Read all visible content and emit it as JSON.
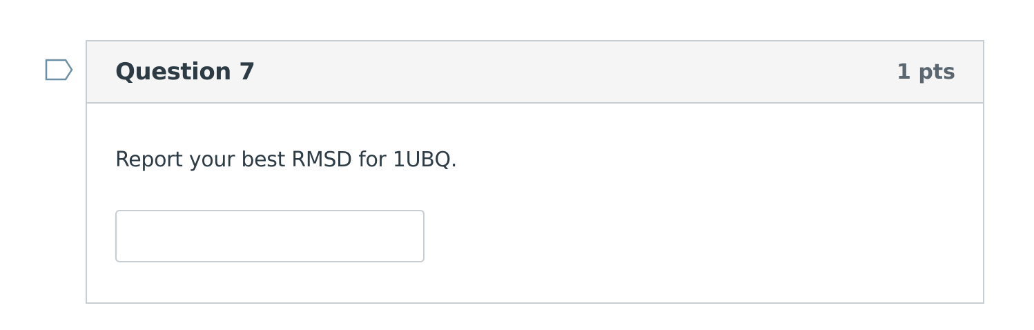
{
  "question": {
    "title": "Question 7",
    "points": "1 pts",
    "text": "Report your best RMSD for 1UBQ.",
    "answer_value": "",
    "answer_placeholder": "",
    "flag_icon": "flag-question-icon"
  },
  "colors": {
    "header_bg": "#f5f5f5",
    "border": "#c7cdd1",
    "text": "#2d3b45",
    "points_text": "#5b6770",
    "flag_stroke": "#6c8fa5"
  }
}
